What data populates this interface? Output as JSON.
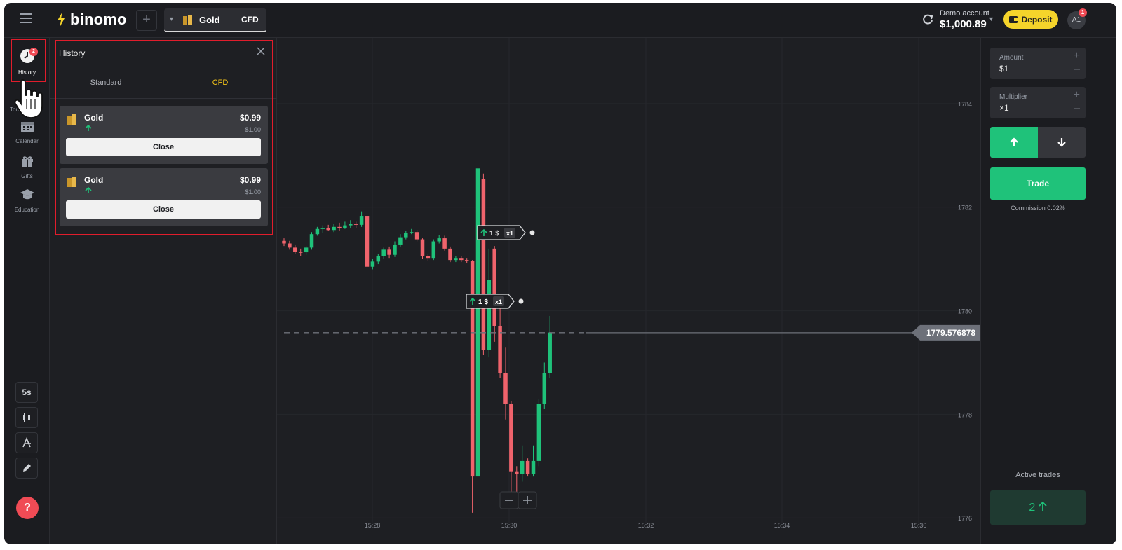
{
  "brand": {
    "name": "binomo"
  },
  "header": {
    "asset_tab": {
      "name": "Gold",
      "type": "CFD"
    },
    "account": {
      "label": "Demo account",
      "balance": "$1,000.89"
    },
    "deposit_label": "Deposit",
    "avatar_initials": "A1",
    "avatar_badge": "1"
  },
  "leftnav": {
    "items": [
      {
        "label": "History",
        "badge": "2",
        "icon": "history-icon"
      },
      {
        "label": "Tou",
        "icon": "tournaments-icon"
      },
      {
        "label": "Calendar",
        "icon": "calendar-icon"
      },
      {
        "label": "Gifts",
        "icon": "gift-icon"
      },
      {
        "label": "Education",
        "icon": "education-icon"
      }
    ],
    "tools": {
      "timeframe": "5s"
    },
    "help_label": "?"
  },
  "history_panel": {
    "title": "History",
    "tabs": [
      {
        "label": "Standard"
      },
      {
        "label": "CFD",
        "active": true
      }
    ],
    "trades": [
      {
        "asset": "Gold",
        "direction": "up",
        "value": "$0.99",
        "investment": "$1.00",
        "close_label": "Close"
      },
      {
        "asset": "Gold",
        "direction": "up",
        "value": "$0.99",
        "investment": "$1.00",
        "close_label": "Close"
      }
    ]
  },
  "chart": {
    "current_price": "1779.576878",
    "y_ticks": [
      "1784",
      "1782",
      "1780",
      "1778",
      "1776"
    ],
    "x_ticks": [
      "15:28",
      "15:30",
      "15:32",
      "15:34",
      "15:36"
    ],
    "trade_markers": [
      {
        "amount": "1 $",
        "multiplier": "x1"
      },
      {
        "amount": "1 $",
        "multiplier": "x1"
      }
    ],
    "colors": {
      "up": "#1fc27a",
      "down": "#f0636c",
      "background": "#1e1f23"
    }
  },
  "chart_data": {
    "type": "candlestick",
    "y_range": [
      1775.8,
      1785.0
    ],
    "price_line": 1779.576878,
    "candles": [
      {
        "i": 0,
        "o": 1781.35,
        "c": 1781.3,
        "h": 1781.4,
        "l": 1781.25
      },
      {
        "i": 1,
        "o": 1781.3,
        "c": 1781.22,
        "h": 1781.35,
        "l": 1781.18
      },
      {
        "i": 2,
        "o": 1781.22,
        "c": 1781.14,
        "h": 1781.28,
        "l": 1781.1
      },
      {
        "i": 3,
        "o": 1781.14,
        "c": 1781.13,
        "h": 1781.2,
        "l": 1781.05
      },
      {
        "i": 4,
        "o": 1781.13,
        "c": 1781.22,
        "h": 1781.25,
        "l": 1781.08
      },
      {
        "i": 5,
        "o": 1781.22,
        "c": 1781.48,
        "h": 1781.52,
        "l": 1781.18
      },
      {
        "i": 6,
        "o": 1781.48,
        "c": 1781.58,
        "h": 1781.62,
        "l": 1781.45
      },
      {
        "i": 7,
        "o": 1781.58,
        "c": 1781.6,
        "h": 1781.65,
        "l": 1781.5
      },
      {
        "i": 8,
        "o": 1781.6,
        "c": 1781.56,
        "h": 1781.66,
        "l": 1781.54
      },
      {
        "i": 9,
        "o": 1781.56,
        "c": 1781.62,
        "h": 1781.68,
        "l": 1781.52
      },
      {
        "i": 10,
        "o": 1781.62,
        "c": 1781.6,
        "h": 1781.7,
        "l": 1781.55
      },
      {
        "i": 11,
        "o": 1781.6,
        "c": 1781.65,
        "h": 1781.72,
        "l": 1781.58
      },
      {
        "i": 12,
        "o": 1781.65,
        "c": 1781.68,
        "h": 1781.75,
        "l": 1781.6
      },
      {
        "i": 13,
        "o": 1781.68,
        "c": 1781.66,
        "h": 1781.72,
        "l": 1781.6
      },
      {
        "i": 14,
        "o": 1781.66,
        "c": 1781.82,
        "h": 1781.92,
        "l": 1781.62
      },
      {
        "i": 15,
        "o": 1781.82,
        "c": 1780.85,
        "h": 1781.85,
        "l": 1780.8
      },
      {
        "i": 16,
        "o": 1780.85,
        "c": 1780.95,
        "h": 1781.0,
        "l": 1780.8
      },
      {
        "i": 17,
        "o": 1780.95,
        "c": 1781.05,
        "h": 1781.1,
        "l": 1780.9
      },
      {
        "i": 18,
        "o": 1781.05,
        "c": 1781.18,
        "h": 1781.22,
        "l": 1781.0
      },
      {
        "i": 19,
        "o": 1781.18,
        "c": 1781.08,
        "h": 1781.24,
        "l": 1781.02
      },
      {
        "i": 20,
        "o": 1781.08,
        "c": 1781.28,
        "h": 1781.34,
        "l": 1781.04
      },
      {
        "i": 21,
        "o": 1781.28,
        "c": 1781.42,
        "h": 1781.48,
        "l": 1781.24
      },
      {
        "i": 22,
        "o": 1781.42,
        "c": 1781.5,
        "h": 1781.55,
        "l": 1781.38
      },
      {
        "i": 23,
        "o": 1781.5,
        "c": 1781.52,
        "h": 1781.58,
        "l": 1781.48
      },
      {
        "i": 24,
        "o": 1781.52,
        "c": 1781.38,
        "h": 1781.56,
        "l": 1781.34
      },
      {
        "i": 25,
        "o": 1781.38,
        "c": 1781.05,
        "h": 1781.4,
        "l": 1781.0
      },
      {
        "i": 26,
        "o": 1781.05,
        "c": 1781.02,
        "h": 1781.1,
        "l": 1780.96
      },
      {
        "i": 27,
        "o": 1781.02,
        "c": 1781.34,
        "h": 1781.38,
        "l": 1780.98
      },
      {
        "i": 28,
        "o": 1781.34,
        "c": 1781.4,
        "h": 1781.46,
        "l": 1781.3
      },
      {
        "i": 29,
        "o": 1781.4,
        "c": 1781.2,
        "h": 1781.45,
        "l": 1781.16
      },
      {
        "i": 30,
        "o": 1781.2,
        "c": 1780.98,
        "h": 1781.24,
        "l": 1780.94
      },
      {
        "i": 31,
        "o": 1780.98,
        "c": 1781.02,
        "h": 1781.06,
        "l": 1780.94
      },
      {
        "i": 32,
        "o": 1781.02,
        "c": 1780.98,
        "h": 1781.06,
        "l": 1780.94
      },
      {
        "i": 33,
        "o": 1780.98,
        "c": 1780.96,
        "h": 1781.02,
        "l": 1780.92
      },
      {
        "i": 34,
        "o": 1780.96,
        "c": 1776.8,
        "h": 1780.98,
        "l": 1776.1
      },
      {
        "i": 35,
        "o": 1776.8,
        "c": 1782.75,
        "h": 1784.1,
        "l": 1776.7
      },
      {
        "i": 36,
        "o": 1782.55,
        "c": 1779.25,
        "h": 1782.65,
        "l": 1779.15
      },
      {
        "i": 37,
        "o": 1779.25,
        "c": 1780.6,
        "h": 1781.2,
        "l": 1779.1
      },
      {
        "i": 38,
        "o": 1781.2,
        "c": 1779.7,
        "h": 1781.25,
        "l": 1779.4
      },
      {
        "i": 39,
        "o": 1779.7,
        "c": 1778.8,
        "h": 1780.3,
        "l": 1778.7
      },
      {
        "i": 40,
        "o": 1778.8,
        "c": 1778.2,
        "h": 1779.3,
        "l": 1777.9
      },
      {
        "i": 41,
        "o": 1778.2,
        "c": 1776.9,
        "h": 1778.25,
        "l": 1776.4
      },
      {
        "i": 42,
        "o": 1776.9,
        "c": 1776.85,
        "h": 1777.0,
        "l": 1776.4
      },
      {
        "i": 43,
        "o": 1776.85,
        "c": 1777.1,
        "h": 1777.4,
        "l": 1776.7
      },
      {
        "i": 44,
        "o": 1777.1,
        "c": 1776.85,
        "h": 1777.15,
        "l": 1776.8
      },
      {
        "i": 45,
        "o": 1776.85,
        "c": 1777.1,
        "h": 1777.4,
        "l": 1776.8
      },
      {
        "i": 46,
        "o": 1777.1,
        "c": 1778.2,
        "h": 1778.3,
        "l": 1777.0
      },
      {
        "i": 47,
        "o": 1778.2,
        "c": 1778.8,
        "h": 1779.0,
        "l": 1778.1
      },
      {
        "i": 48,
        "o": 1778.8,
        "c": 1779.58,
        "h": 1779.9,
        "l": 1778.7
      }
    ]
  },
  "right_panel": {
    "amount": {
      "label": "Amount",
      "value": "$1"
    },
    "multiplier": {
      "label": "Multiplier",
      "value": "×1"
    },
    "trade_label": "Trade",
    "commission": "Commission 0.02%",
    "active_trades_label": "Active trades",
    "active_trades_count": "2"
  }
}
